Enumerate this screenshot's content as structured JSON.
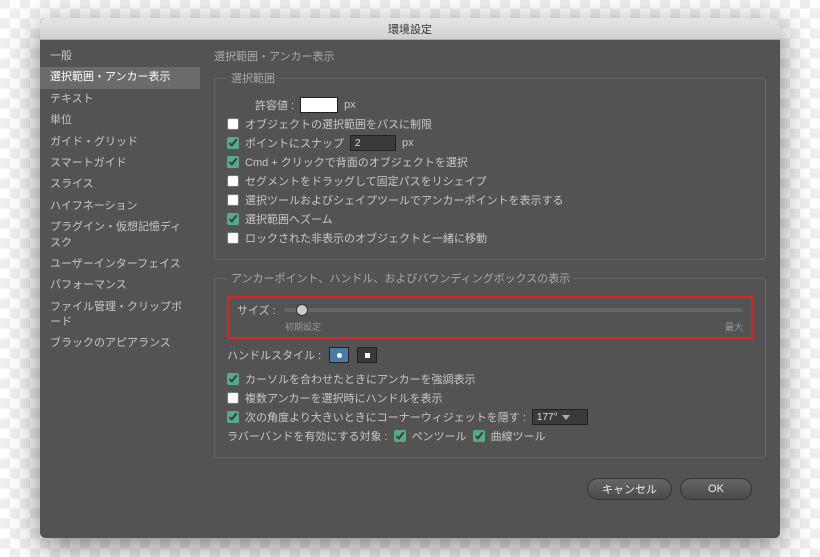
{
  "title": "環境設定",
  "sidebar": {
    "items": [
      {
        "label": "一般"
      },
      {
        "label": "選択範囲・アンカー表示"
      },
      {
        "label": "テキスト"
      },
      {
        "label": "単位"
      },
      {
        "label": "ガイド・グリッド"
      },
      {
        "label": "スマートガイド"
      },
      {
        "label": "スライス"
      },
      {
        "label": "ハイフネーション"
      },
      {
        "label": "プラグイン・仮想記憶ディスク"
      },
      {
        "label": "ユーザーインターフェイス"
      },
      {
        "label": "パフォーマンス"
      },
      {
        "label": "ファイル管理・クリップボード"
      },
      {
        "label": "ブラックのアピアランス"
      }
    ],
    "activeIndex": 1
  },
  "main": {
    "heading": "選択範囲・アンカー表示",
    "selection": {
      "legend": "選択範囲",
      "tolerance_label": "許容値 :",
      "tolerance_value": "",
      "px": "px",
      "constrain": {
        "checked": false,
        "label": "オブジェクトの選択範囲をパスに制限"
      },
      "snap": {
        "checked": true,
        "label": "ポイントにスナップ",
        "value": "2",
        "px": "px"
      },
      "cmdclick": {
        "checked": true,
        "label": "Cmd + クリックで背面のオブジェクトを選択"
      },
      "segment": {
        "checked": false,
        "label": "セグメントをドラッグして固定パスをリシェイプ"
      },
      "shapetool": {
        "checked": false,
        "label": "選択ツールおよびシェイプツールでアンカーポイントを表示する"
      },
      "zoom": {
        "checked": true,
        "label": "選択範囲へズーム"
      },
      "locked": {
        "checked": false,
        "label": "ロックされた非表示のオブジェクトと一緒に移動"
      }
    },
    "anchor": {
      "legend": "アンカーポイント、ハンドル、およびバウンディングボックスの表示",
      "size_label": "サイズ :",
      "size_min": "初期設定",
      "size_max": "最大",
      "handle_style_label": "ハンドルスタイル :",
      "highlight": {
        "checked": true,
        "label": "カーソルを合わせたときにアンカーを強調表示"
      },
      "multi": {
        "checked": false,
        "label": "複数アンカーを選択時にハンドルを表示"
      },
      "corner": {
        "checked": true,
        "label": "次の角度より大きいときにコーナーウィジェットを隠す :",
        "value": "177°"
      },
      "rubber_label": "ラバーバンドを有効にする対象 :",
      "pen": {
        "checked": true,
        "label": "ペンツール"
      },
      "curve": {
        "checked": true,
        "label": "曲線ツール"
      }
    }
  },
  "buttons": {
    "cancel": "キャンセル",
    "ok": "OK"
  }
}
